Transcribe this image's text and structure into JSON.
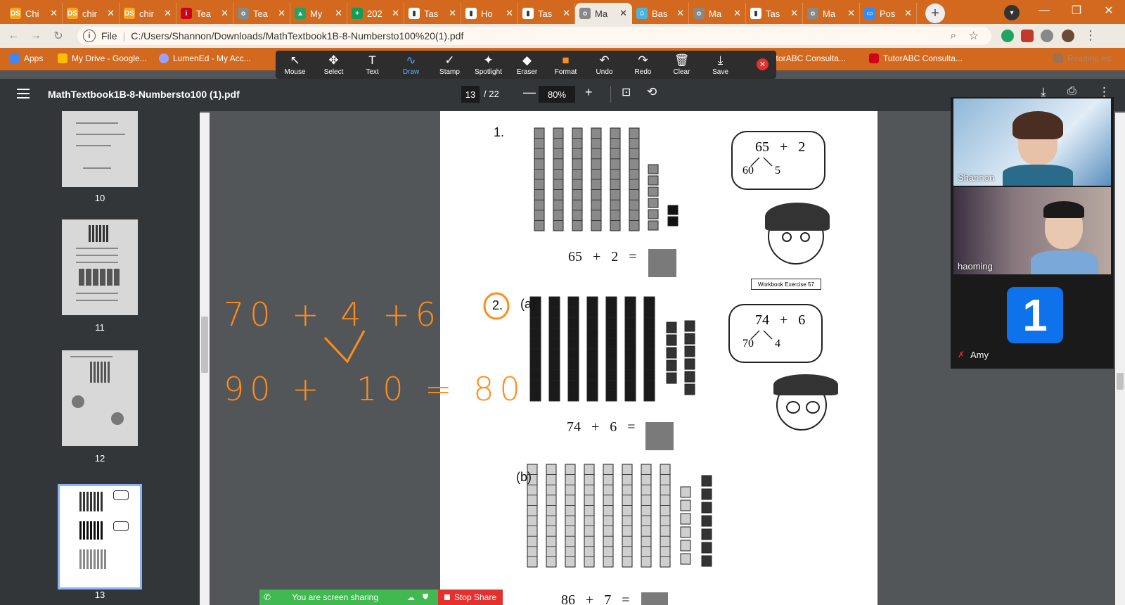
{
  "tabs": [
    {
      "title": "Chi",
      "fav": "DS",
      "color": "#f5a623"
    },
    {
      "title": "chir",
      "fav": "DS",
      "color": "#f5a623"
    },
    {
      "title": "chir",
      "fav": "DS",
      "color": "#f5a623"
    },
    {
      "title": "Tea",
      "fav": "i",
      "color": "#d0021b"
    },
    {
      "title": "Tea",
      "fav": "o",
      "color": "#888888"
    },
    {
      "title": "My",
      "fav": "▲",
      "color": "#1fa463"
    },
    {
      "title": "202",
      "fav": "+",
      "color": "#0f9d58"
    },
    {
      "title": "Tas",
      "fav": "▮",
      "color": "#ffffff"
    },
    {
      "title": "Ho",
      "fav": "▮",
      "color": "#ffffff"
    },
    {
      "title": "Tas",
      "fav": "▮",
      "color": "#ffffff"
    },
    {
      "title": "Ma",
      "fav": "o",
      "color": "#888888"
    },
    {
      "title": "Bas",
      "fav": "☺",
      "color": "#4ab3e0"
    },
    {
      "title": "Ma",
      "fav": "o",
      "color": "#888888"
    },
    {
      "title": "Tas",
      "fav": "▮",
      "color": "#ffffff"
    },
    {
      "title": "Ma",
      "fav": "o",
      "color": "#888888"
    },
    {
      "title": "Pos",
      "fav": "▭",
      "color": "#2d8cff"
    }
  ],
  "active_tab": 10,
  "address": {
    "label": "File",
    "url": "C:/Users/Shannon/Downloads/MathTextbook1B-8-Numbersto100%20(1).pdf"
  },
  "bookmarks": [
    {
      "label": "Apps",
      "color": "#4285f4"
    },
    {
      "label": "My Drive - Google...",
      "color": "#fbbc05"
    },
    {
      "label": "LumenEd - My Acc...",
      "color": "#9aa0ff"
    }
  ],
  "bookmarks_right": [
    {
      "label": "TutorABC Consulta...",
      "color": "#d0021b"
    },
    {
      "label": "TutorABC Consulta...",
      "color": "#d0021b"
    },
    {
      "label": "Reading list",
      "color": "#888888"
    }
  ],
  "annotate": {
    "tools": [
      {
        "label": "Mouse",
        "icon": "↖"
      },
      {
        "label": "Select",
        "icon": "✥"
      },
      {
        "label": "Text",
        "icon": "T"
      },
      {
        "label": "Draw",
        "icon": "∿"
      },
      {
        "label": "Stamp",
        "icon": "✓"
      },
      {
        "label": "Spotlight",
        "icon": "✦"
      },
      {
        "label": "Eraser",
        "icon": "◆"
      },
      {
        "label": "Format",
        "icon": "■"
      },
      {
        "label": "Undo",
        "icon": "↶"
      },
      {
        "label": "Redo",
        "icon": "↷"
      },
      {
        "label": "Clear",
        "icon": "🗑"
      },
      {
        "label": "Save",
        "icon": "⤓"
      }
    ],
    "active": 3,
    "format_color": "#ff8c1a"
  },
  "pdf": {
    "title": "MathTextbook1B-8-Numbersto100 (1).pdf",
    "page": "13",
    "total": "/ 22",
    "zoom": "80%"
  },
  "thumbnails": [
    "10",
    "11",
    "12",
    "13"
  ],
  "page": {
    "q1": {
      "label": "1.",
      "equation": "65   +   2   =",
      "cloud": "65   +   2",
      "split_left": "60",
      "split_right": "5",
      "tag": "Workbook  Exercise  57"
    },
    "q2": {
      "label": "2.",
      "part": "(a)",
      "equation": "74   +   6   =",
      "cloud": "74   +   6",
      "split_left": "70",
      "split_right": "4"
    },
    "q2b": {
      "part": "(b)",
      "equation": "86   +   7   ="
    }
  },
  "handwriting": {
    "line1": "70 + 4 +6",
    "line2": "90 +  10 = 80"
  },
  "participants": [
    {
      "name": "Shannon"
    },
    {
      "name": "haoming"
    },
    {
      "name": "Amy",
      "badge": "1"
    }
  ],
  "share": {
    "text": "You are screen sharing",
    "stop": "Stop Share"
  }
}
